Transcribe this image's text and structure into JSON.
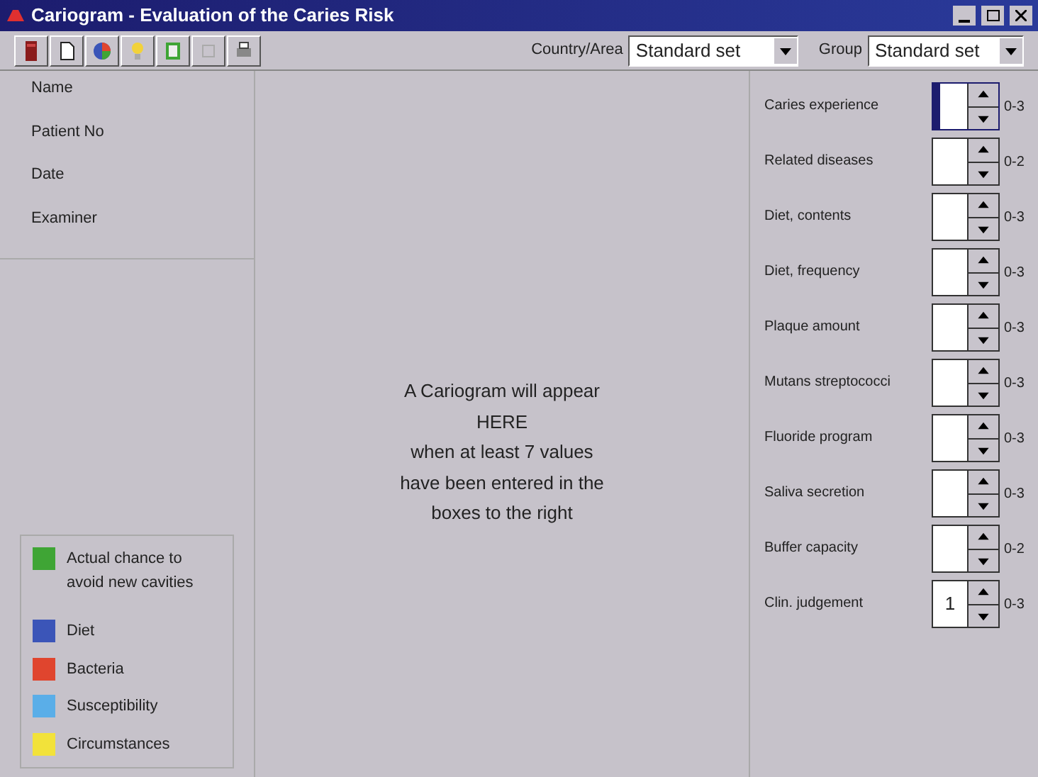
{
  "window": {
    "title": "Cariogram - Evaluation of the Caries Risk"
  },
  "toolbar": {
    "tools": [
      {
        "kind": "book"
      },
      {
        "kind": "page"
      },
      {
        "kind": "chart"
      },
      {
        "kind": "help"
      },
      {
        "kind": "number"
      },
      {
        "kind": "blank"
      },
      {
        "kind": "print"
      }
    ],
    "country": {
      "label": "Country/Area",
      "value": "Standard set"
    },
    "group": {
      "label": "Group",
      "value": "Standard set"
    }
  },
  "patient_fields": [
    "Name",
    "Patient No",
    "Date",
    "Examiner"
  ],
  "message": [
    "A Cariogram will appear",
    "HERE",
    "when at least 7 values",
    "have been entered in the",
    "boxes to the right"
  ],
  "legend": [
    {
      "label": "Actual chance to avoid new cavities",
      "color": "#3fa535"
    },
    {
      "label": "Diet",
      "color": "#3b55b8"
    },
    {
      "label": "Bacteria",
      "color": "#e0452e"
    },
    {
      "label": "Susceptibility",
      "color": "#5aaee8"
    },
    {
      "label": "Circumstances",
      "color": "#f2e23a"
    }
  ],
  "factors": [
    {
      "label": "Caries experience",
      "range": "0-3",
      "focused": true
    },
    {
      "label": "Related diseases",
      "range": "0-2",
      "focused": false
    },
    {
      "label": "Diet, contents",
      "range": "0-3",
      "focused": false
    },
    {
      "label": "Diet, frequency",
      "range": "0-3",
      "focused": false
    },
    {
      "label": "Plaque amount",
      "range": "0-3",
      "focused": false
    },
    {
      "label": "Mutans streptococci",
      "range": "0-3",
      "focused": false
    },
    {
      "label": "Fluoride program",
      "range": "0-3",
      "focused": false
    },
    {
      "label": "Saliva secretion",
      "range": "0-3",
      "focused": false
    },
    {
      "label": "Buffer capacity",
      "range": "0-2",
      "focused": false
    },
    {
      "label": "Clin. judgement",
      "value": "1",
      "range": "0-3",
      "focused": false
    }
  ]
}
